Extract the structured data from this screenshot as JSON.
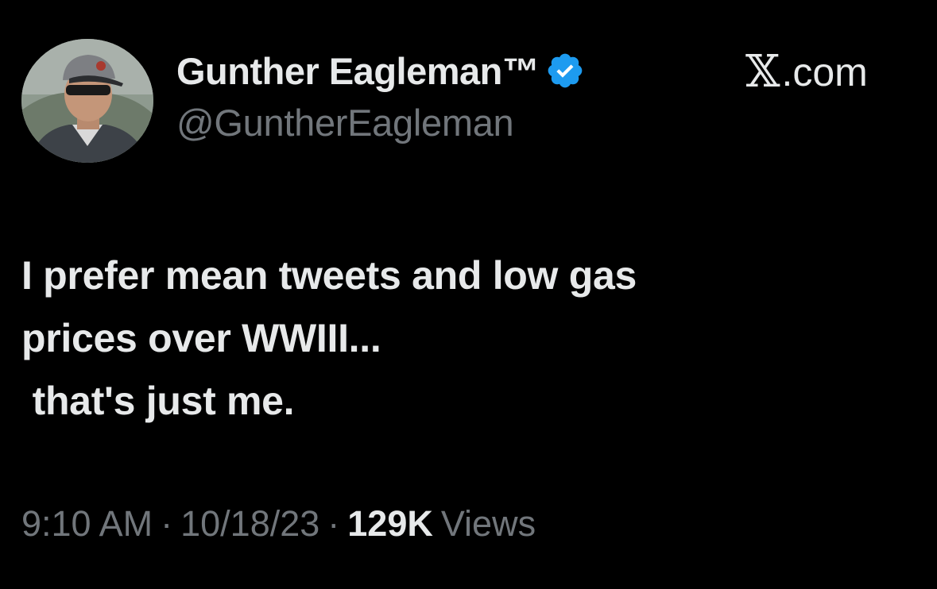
{
  "author": {
    "display_name": "Gunther Eagleman™",
    "handle": "@GuntherEagleman",
    "verified": true,
    "avatar_icon": "profile-photo-man-in-cap-and-sunglasses"
  },
  "brand": {
    "x_glyph": "𝕏",
    "domain": ".com"
  },
  "tweet": {
    "lines": [
      "I prefer mean tweets and low gas",
      "prices over WWIII...",
      " that's just me."
    ]
  },
  "meta": {
    "time": "9:10 AM",
    "separator": "·",
    "date": "10/18/23",
    "views_count": "129K",
    "views_label": "Views"
  },
  "colors": {
    "background": "#000000",
    "primary_text": "#e7e9ea",
    "secondary_text": "#71767b",
    "verified_badge": "#1d9bf0"
  }
}
